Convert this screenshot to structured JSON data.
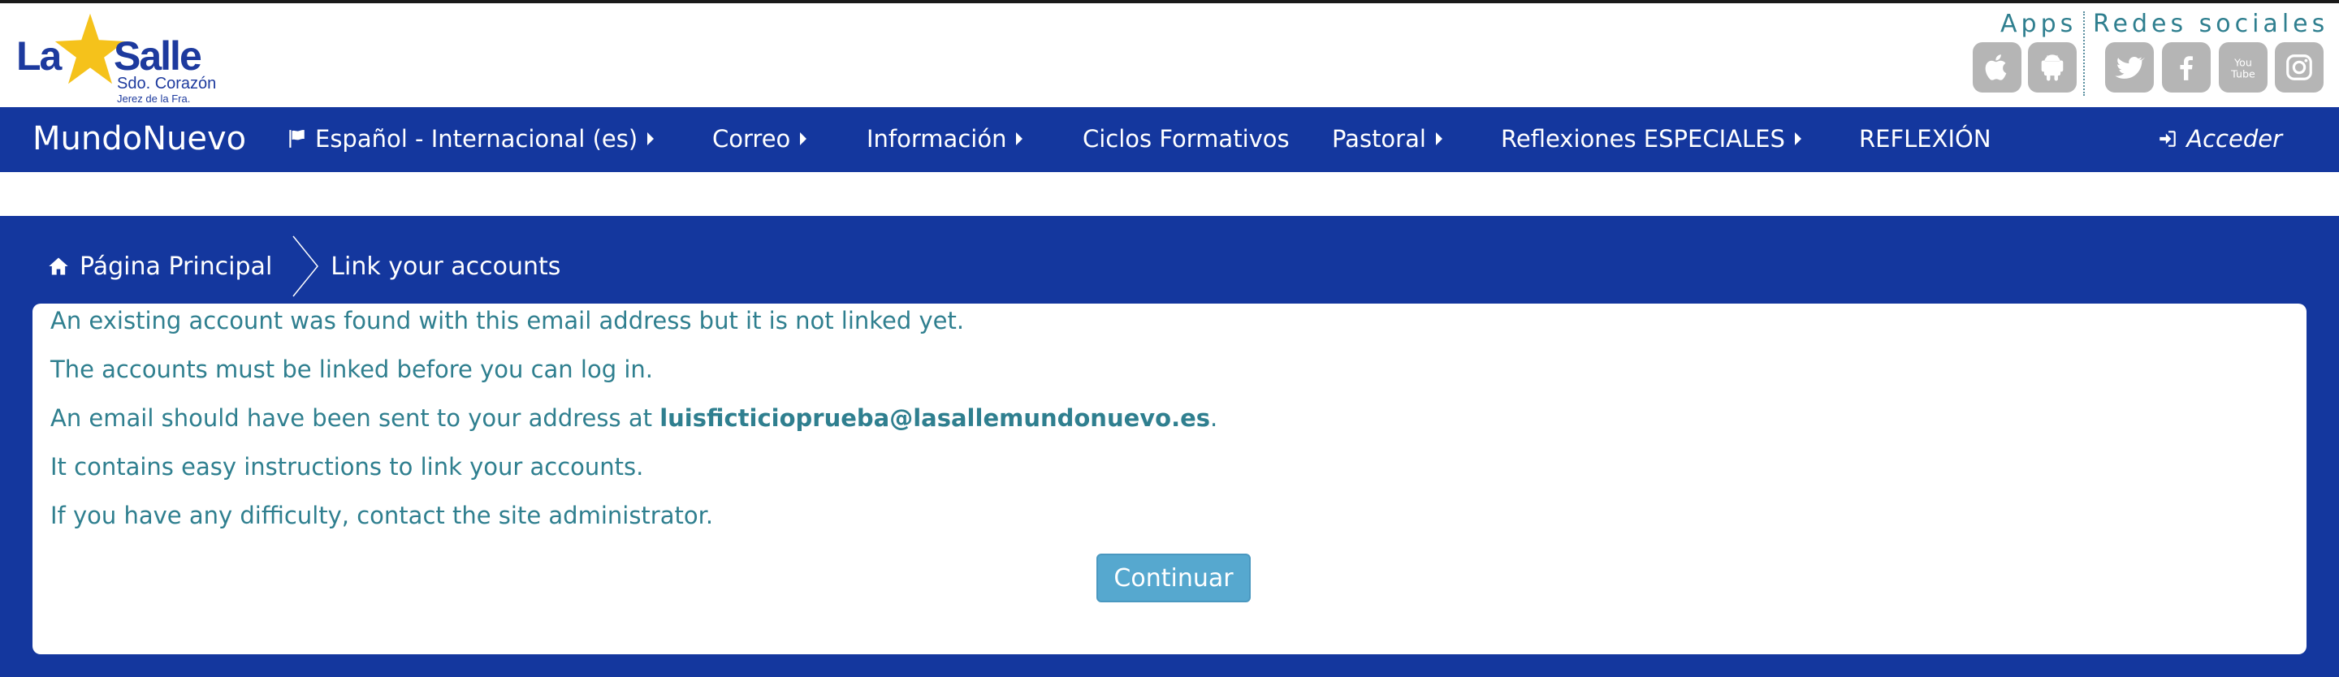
{
  "header": {
    "logo": {
      "main_left": "La",
      "main_right": "Salle",
      "subtitle": "Sdo. Corazón",
      "location": "Jerez de la Fra."
    },
    "apps_label": "Apps",
    "social_label": "Redes sociales",
    "app_icons": [
      "apple-icon",
      "android-icon"
    ],
    "social_icons": [
      "twitter-icon",
      "facebook-icon",
      "youtube-icon",
      "instagram-icon"
    ]
  },
  "navbar": {
    "brand": "MundoNuevo",
    "items": [
      {
        "label": "Español - Internacional (es)",
        "dropdown": true
      },
      {
        "label": "Correo",
        "dropdown": true
      },
      {
        "label": "Información",
        "dropdown": true
      },
      {
        "label": "Ciclos Formativos",
        "dropdown": false
      },
      {
        "label": "Pastoral",
        "dropdown": true
      },
      {
        "label": "Reflexiones ESPECIALES",
        "dropdown": true
      },
      {
        "label": "REFLEXIÓN",
        "dropdown": false
      }
    ],
    "login_label": "Acceder"
  },
  "breadcrumb": {
    "home_label": "Página Principal",
    "current_label": "Link your accounts"
  },
  "message": {
    "line1": "An existing account was found with this email address but it is not linked yet.",
    "line2": "The accounts must be linked before you can log in.",
    "line3_prefix": "An email should have been sent to your address at ",
    "line3_email": "luisficticioprueba@lasallemundonuevo.es",
    "line3_suffix": ".",
    "line4": "It contains easy instructions to link your accounts.",
    "line5": "If you have any difficulty, contact the site administrator."
  },
  "continue_button": "Continuar",
  "colors": {
    "navy": "#14379e",
    "text_teal": "#2f7f8f",
    "button": "#56a8cf",
    "icon_gray": "#b5b5b5",
    "star_yellow": "#f5c21b"
  }
}
